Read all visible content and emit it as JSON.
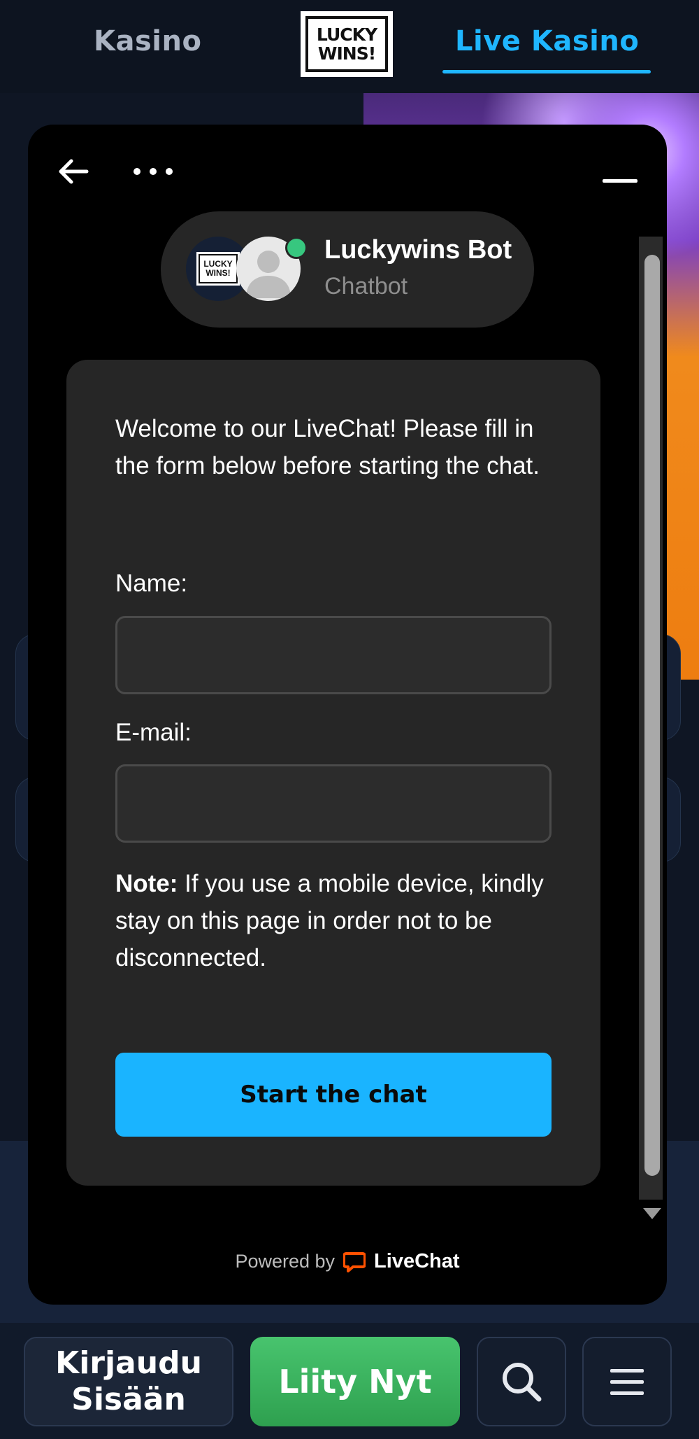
{
  "header": {
    "tab_kasino": "Kasino",
    "tab_live_kasino": "Live Kasino",
    "logo_line1": "LUCKY",
    "logo_line2": "WINS!"
  },
  "chat": {
    "back_icon": "arrow-left-icon",
    "more_icon": "more-horizontal-icon",
    "minimize_icon": "minimize-icon",
    "bot": {
      "name": "Luckywins Bot",
      "subtitle": "Chatbot",
      "avatar_logo_line1": "LUCKY",
      "avatar_logo_line2": "WINS!",
      "status_color": "#37c77f"
    },
    "form": {
      "welcome": "Welcome to our LiveChat! Please fill in the form below before starting the chat.",
      "name_label": "Name:",
      "name_value": "",
      "email_label": "E-mail:",
      "email_value": "",
      "note_bold": "Note:",
      "note_text": " If you use a mobile device, kindly stay on this page in order not to be disconnected.",
      "start_button": "Start the chat"
    },
    "footer": {
      "powered_by": "Powered by",
      "brand": "LiveChat",
      "brand_color": "#ff5100"
    }
  },
  "bottom_bar": {
    "login_line1": "Kirjaudu",
    "login_line2": "Sisään",
    "join": "Liity Nyt",
    "search_icon": "search-icon",
    "menu_icon": "menu-icon"
  },
  "colors": {
    "accent": "#1fb6ff",
    "start_button": "#1ab4ff",
    "join_green": "#3fb560",
    "background": "#0f1624"
  }
}
